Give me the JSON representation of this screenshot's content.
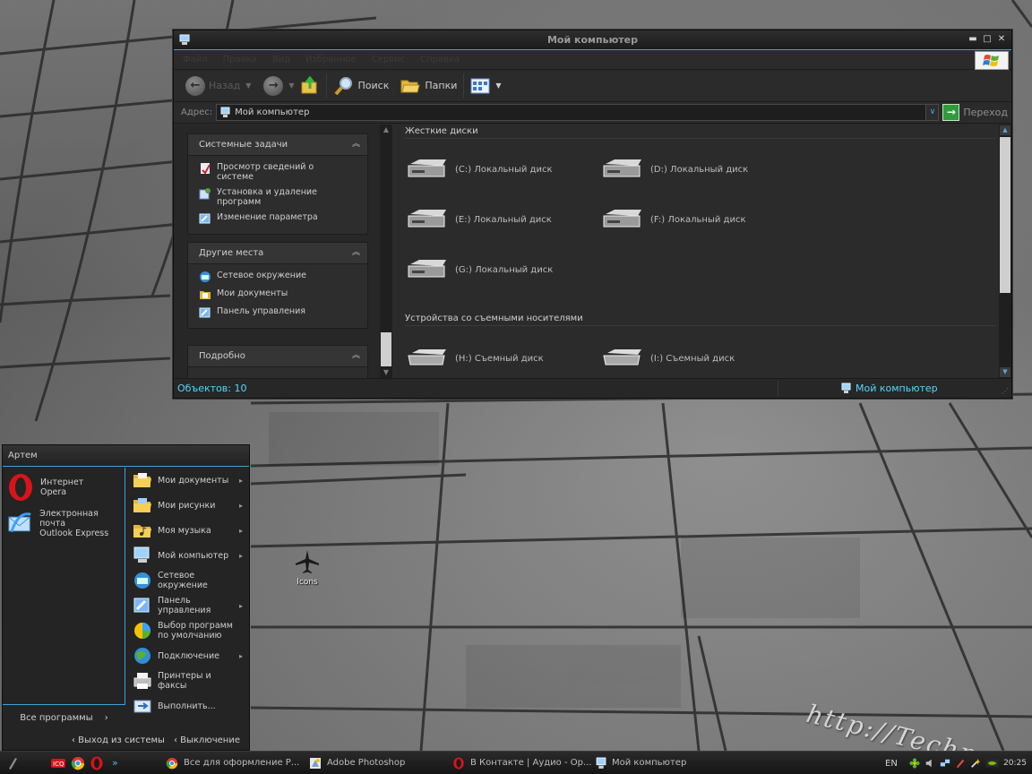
{
  "window": {
    "title": "Мой компьютер",
    "menu": [
      "Файл",
      "Правка",
      "Вид",
      "Избранное",
      "Сервис",
      "Справка"
    ],
    "toolbar": {
      "back": "Назад",
      "search": "Поиск",
      "folders": "Папки"
    },
    "address": {
      "label": "Адрес:",
      "value": "Мой компьютер",
      "go": "Переход"
    },
    "tasks": {
      "system": {
        "title": "Системные задачи",
        "items": [
          "Просмотр сведений о системе",
          "Установка и удаление программ",
          "Изменение параметра"
        ]
      },
      "places": {
        "title": "Другие места",
        "items": [
          "Сетевое окружение",
          "Мои документы",
          "Панель управления"
        ]
      },
      "details": {
        "title": "Подробно"
      }
    },
    "groups": {
      "hard_drives": "Жесткие диски",
      "removable": "Устройства со съемными носителями"
    },
    "drives": [
      "(C:) Локальный диск",
      "(D:) Локальный диск",
      "(E:) Локальный диск",
      "(F:) Локальный диск",
      "(G:) Локальный диск"
    ],
    "removable": [
      "(H:) Съемный диск",
      "(I:) Съемный диск"
    ],
    "status": {
      "count": "Объектов: 10",
      "location": "Мой компьютер"
    }
  },
  "desktop": {
    "icon_label": "Icons",
    "watermark": "http://Techpc.ru"
  },
  "start_menu": {
    "user": "Артем",
    "pinned": [
      {
        "line1": "Интернет",
        "line2": "Opera"
      },
      {
        "line1": "Электронная почта",
        "line2": "Outlook Express"
      }
    ],
    "all_programs": "Все программы",
    "right": [
      {
        "label": "Мои документы",
        "arrow": true
      },
      {
        "label": "Мои рисунки",
        "arrow": true
      },
      {
        "label": "Моя музыка",
        "arrow": true
      },
      {
        "label": "Мой компьютер",
        "arrow": true
      },
      {
        "label": "Сетевое окружение",
        "arrow": false
      },
      {
        "label": "Панель управления",
        "arrow": true
      },
      {
        "label": "Выбор программ по умолчанию",
        "arrow": false
      },
      {
        "label": "Подключение",
        "arrow": true
      },
      {
        "label": "Принтеры и факсы",
        "arrow": false
      },
      {
        "label": "Выполнить...",
        "arrow": false
      }
    ],
    "logoff": "Выход из системы",
    "shutdown": "Выключение"
  },
  "taskbar": {
    "tasks": [
      "Все для оформление Р...",
      "Adobe Photoshop",
      "В Контакте | Аудио - Ор...",
      "Мой компьютер"
    ],
    "lang": "EN",
    "clock": "20:25"
  },
  "colors": {
    "accent": "#3aa4d8",
    "status_text": "#58d6ff",
    "window_bg": "#2b2b2b"
  }
}
